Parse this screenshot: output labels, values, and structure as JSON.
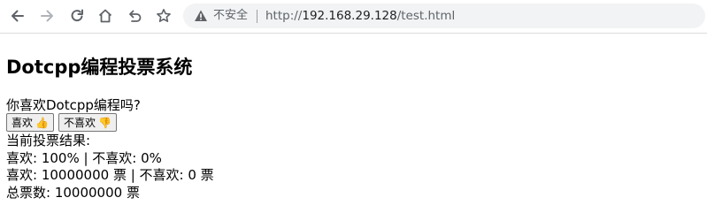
{
  "browser": {
    "insecure_label": "不安全",
    "url_scheme": "http://",
    "url_host": "192.168.29.128",
    "url_path": "/test.html"
  },
  "page": {
    "title": "Dotcpp编程投票系统",
    "question": "你喜欢Dotcpp编程吗?",
    "like_button": {
      "label": "喜欢",
      "emoji": "👍"
    },
    "dislike_button": {
      "label": "不喜欢",
      "emoji": "👎"
    },
    "results_heading": "当前投票结果:",
    "percent_line": "喜欢: 100% | 不喜欢: 0%",
    "votes_line": "喜欢: 10000000 票 | 不喜欢: 0 票",
    "total_line": "总票数: 10000000 票"
  },
  "colors": {
    "icon": "#5f6368",
    "address_bg": "#f1f3f4"
  }
}
